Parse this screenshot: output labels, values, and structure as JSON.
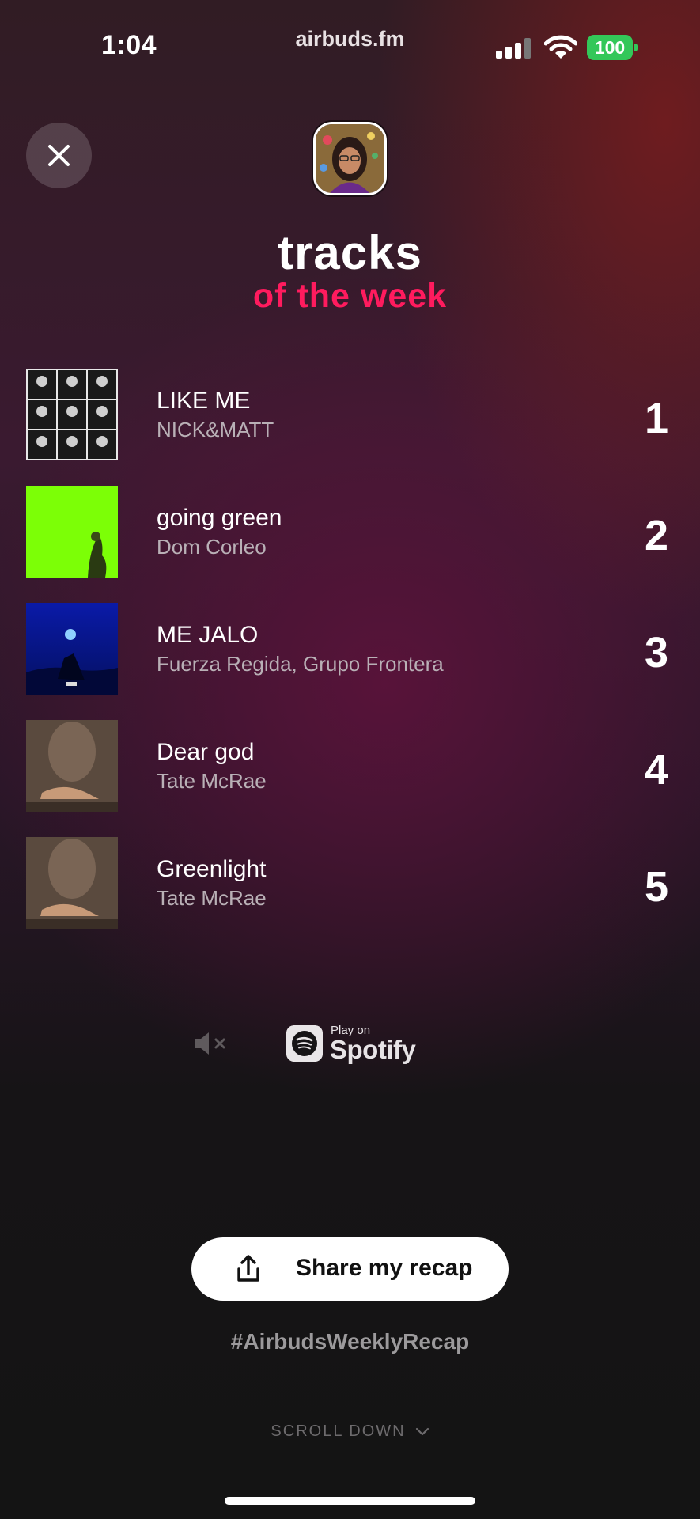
{
  "status_bar": {
    "time": "1:04",
    "site": "airbuds.fm",
    "battery": "100",
    "icons": [
      "cellular-signal-icon",
      "wifi-icon",
      "battery-icon"
    ]
  },
  "header": {
    "close_icon": "close-icon",
    "title": "tracks",
    "subtitle": "of the week"
  },
  "tracks": [
    {
      "name": "LIKE ME",
      "artist": "NICK&MATT",
      "rank": "1"
    },
    {
      "name": "going green",
      "artist": "Dom Corleo",
      "rank": "2"
    },
    {
      "name": "ME JALO",
      "artist": "Fuerza Regida, Grupo Frontera",
      "rank": "3"
    },
    {
      "name": "Dear god",
      "artist": "Tate McRae",
      "rank": "4"
    },
    {
      "name": "Greenlight",
      "artist": "Tate McRae",
      "rank": "5"
    }
  ],
  "player": {
    "mute_icon": "speaker-muted-icon",
    "spotify_pre": "Play on",
    "spotify_brand": "Spotify"
  },
  "share": {
    "label": "Share my recap",
    "icon": "share-icon"
  },
  "hashtag": "#AirbudsWeeklyRecap",
  "scroll_hint": "SCROLL DOWN",
  "colors": {
    "accent": "#ff1b5e",
    "battery": "#33c759",
    "going_green_art": "#7cff06",
    "me_jalo_art": "#0b1fb0"
  }
}
